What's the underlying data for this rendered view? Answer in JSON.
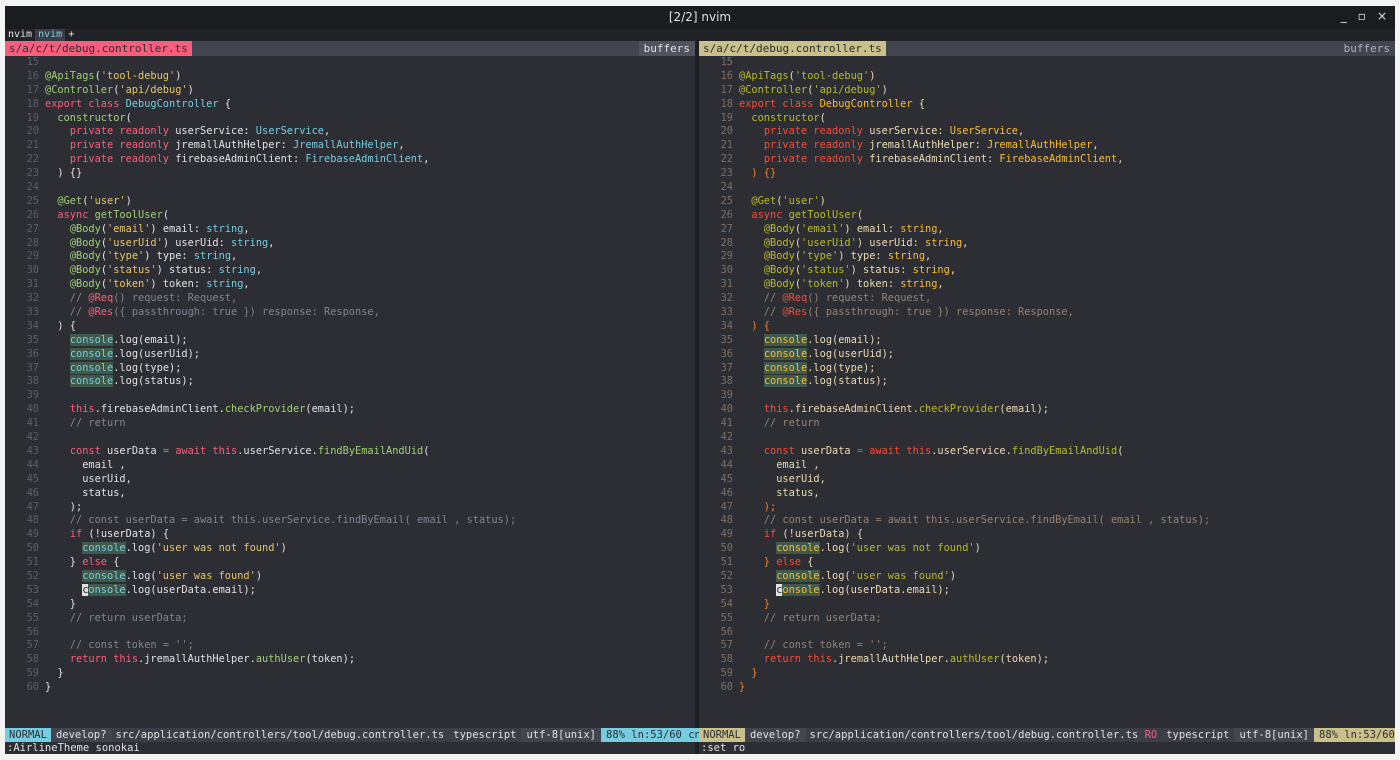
{
  "window": {
    "title": "[2/2] nvim",
    "controls": {
      "minimize": "_",
      "maximize": "▫",
      "close": "×"
    }
  },
  "tabline": {
    "tabs": [
      {
        "label": "nvim",
        "active": false
      },
      {
        "label": "nvim",
        "active": true
      }
    ],
    "add": "+"
  },
  "panes": [
    {
      "filename": "s/a/c/t/debug.controller.ts",
      "buffers_label": "buffers",
      "theme": "sonokai",
      "status": {
        "mode": "NORMAL",
        "branch": "develop?",
        "file": "src/application/controllers/tool/debug.controller.ts",
        "ro": "",
        "filetype": "typescript",
        "encoding": "utf-8[unix]",
        "position": "88% ln:53/60 cn:7"
      },
      "cmdline": ":AirlineTheme sonokai"
    },
    {
      "filename": "s/a/c/t/debug.controller.ts",
      "buffers_label": "buffers",
      "theme": "gruvbox",
      "status": {
        "mode": "NORMAL",
        "branch": "develop?",
        "file": "src/application/controllers/tool/debug.controller.ts",
        "ro": "RO",
        "filetype": "typescript",
        "encoding": "utf-8[unix]",
        "position": "88% ln:53/60 cn:7"
      },
      "cmdline": ":set ro"
    }
  ],
  "themes": {
    "sonokai": {
      "kw": "#fc5d7c",
      "fn": "#9ed072",
      "str": "#e7c664",
      "type": "#76cce0",
      "dec": "#9ed072",
      "cmt": "#7f8490",
      "txt": "#e2e2e3",
      "punc": "#e2e2e3",
      "ln": "#595f6f"
    },
    "gruvbox": {
      "kw": "#fb4934",
      "fn": "#b8bb26",
      "str": "#b8bb26",
      "type": "#fabd2f",
      "dec": "#b8bb26",
      "cmt": "#928374",
      "txt": "#ebdbb2",
      "punc": "#fe8019",
      "ln": "#7c6f64"
    }
  },
  "code": [
    {
      "n": 15,
      "t": []
    },
    {
      "n": 16,
      "t": [
        [
          "dec",
          "@ApiTags"
        ],
        [
          "txt",
          "("
        ],
        [
          "str",
          "'tool-debug'"
        ],
        [
          "txt",
          ")"
        ]
      ]
    },
    {
      "n": 17,
      "t": [
        [
          "dec",
          "@Controller"
        ],
        [
          "txt",
          "("
        ],
        [
          "str",
          "'api/debug'"
        ],
        [
          "txt",
          ")"
        ]
      ]
    },
    {
      "n": 18,
      "t": [
        [
          "kw",
          "export class "
        ],
        [
          "type",
          "DebugController"
        ],
        [
          "txt",
          " {"
        ]
      ]
    },
    {
      "n": 19,
      "t": [
        [
          "txt",
          "  "
        ],
        [
          "fn",
          "constructor"
        ],
        [
          "txt",
          "("
        ]
      ]
    },
    {
      "n": 20,
      "t": [
        [
          "txt",
          "    "
        ],
        [
          "kw",
          "private readonly "
        ],
        [
          "txt",
          "userService: "
        ],
        [
          "type",
          "UserService"
        ],
        [
          "txt",
          ","
        ]
      ]
    },
    {
      "n": 21,
      "t": [
        [
          "txt",
          "    "
        ],
        [
          "kw",
          "private readonly "
        ],
        [
          "txt",
          "jremallAuthHelper: "
        ],
        [
          "type",
          "JremallAuthHelper"
        ],
        [
          "txt",
          ","
        ]
      ]
    },
    {
      "n": 22,
      "t": [
        [
          "txt",
          "    "
        ],
        [
          "kw",
          "private readonly "
        ],
        [
          "txt",
          "firebaseAdminClient: "
        ],
        [
          "type",
          "FirebaseAdminClient"
        ],
        [
          "txt",
          ","
        ]
      ]
    },
    {
      "n": 23,
      "t": [
        [
          "punc",
          "  ) {}"
        ]
      ]
    },
    {
      "n": 24,
      "t": []
    },
    {
      "n": 25,
      "t": [
        [
          "txt",
          "  "
        ],
        [
          "dec",
          "@Get"
        ],
        [
          "txt",
          "("
        ],
        [
          "str",
          "'user'"
        ],
        [
          "txt",
          ")"
        ]
      ]
    },
    {
      "n": 26,
      "t": [
        [
          "txt",
          "  "
        ],
        [
          "kw",
          "async "
        ],
        [
          "fn",
          "getToolUser"
        ],
        [
          "txt",
          "("
        ]
      ]
    },
    {
      "n": 27,
      "t": [
        [
          "txt",
          "    "
        ],
        [
          "dec",
          "@Body"
        ],
        [
          "txt",
          "("
        ],
        [
          "str",
          "'email'"
        ],
        [
          "txt",
          ") email: "
        ],
        [
          "type",
          "string"
        ],
        [
          "txt",
          ","
        ]
      ]
    },
    {
      "n": 28,
      "t": [
        [
          "txt",
          "    "
        ],
        [
          "dec",
          "@Body"
        ],
        [
          "txt",
          "("
        ],
        [
          "str",
          "'userUid'"
        ],
        [
          "txt",
          ") userUid: "
        ],
        [
          "type",
          "string"
        ],
        [
          "txt",
          ","
        ]
      ]
    },
    {
      "n": 29,
      "t": [
        [
          "txt",
          "    "
        ],
        [
          "dec",
          "@Body"
        ],
        [
          "txt",
          "("
        ],
        [
          "str",
          "'type'"
        ],
        [
          "txt",
          ") type: "
        ],
        [
          "type",
          "string"
        ],
        [
          "txt",
          ","
        ]
      ]
    },
    {
      "n": 30,
      "t": [
        [
          "txt",
          "    "
        ],
        [
          "dec",
          "@Body"
        ],
        [
          "txt",
          "("
        ],
        [
          "str",
          "'status'"
        ],
        [
          "txt",
          ") status: "
        ],
        [
          "type",
          "string"
        ],
        [
          "txt",
          ","
        ]
      ]
    },
    {
      "n": 31,
      "t": [
        [
          "txt",
          "    "
        ],
        [
          "dec",
          "@Body"
        ],
        [
          "txt",
          "("
        ],
        [
          "str",
          "'token'"
        ],
        [
          "txt",
          ") token: "
        ],
        [
          "type",
          "string"
        ],
        [
          "txt",
          ","
        ]
      ]
    },
    {
      "n": 32,
      "t": [
        [
          "cmt",
          "    // "
        ],
        [
          "kw",
          "@Req"
        ],
        [
          "cmt",
          "() request: Request,"
        ]
      ]
    },
    {
      "n": 33,
      "t": [
        [
          "cmt",
          "    // "
        ],
        [
          "kw",
          "@Res"
        ],
        [
          "cmt",
          "({ passthrough: true }) response: Response,"
        ]
      ]
    },
    {
      "n": 34,
      "t": [
        [
          "punc",
          "  ) {"
        ]
      ]
    },
    {
      "n": 35,
      "t": [
        [
          "txt",
          "    "
        ],
        [
          "hl",
          "console"
        ],
        [
          "txt",
          ".log(email);"
        ]
      ]
    },
    {
      "n": 36,
      "t": [
        [
          "txt",
          "    "
        ],
        [
          "hl",
          "console"
        ],
        [
          "txt",
          ".log(userUid);"
        ]
      ]
    },
    {
      "n": 37,
      "t": [
        [
          "txt",
          "    "
        ],
        [
          "hl",
          "console"
        ],
        [
          "txt",
          ".log(type);"
        ]
      ]
    },
    {
      "n": 38,
      "t": [
        [
          "txt",
          "    "
        ],
        [
          "hl",
          "console"
        ],
        [
          "txt",
          ".log(status);"
        ]
      ]
    },
    {
      "n": 39,
      "t": []
    },
    {
      "n": 40,
      "t": [
        [
          "txt",
          "    "
        ],
        [
          "kw",
          "this"
        ],
        [
          "txt",
          ".firebaseAdminClient."
        ],
        [
          "fn",
          "checkProvider"
        ],
        [
          "txt",
          "(email);"
        ]
      ]
    },
    {
      "n": 41,
      "t": [
        [
          "cmt",
          "    // return"
        ]
      ]
    },
    {
      "n": 42,
      "t": []
    },
    {
      "n": 43,
      "t": [
        [
          "txt",
          "    "
        ],
        [
          "kw",
          "const "
        ],
        [
          "txt",
          "userData "
        ],
        [
          "kw",
          "= await "
        ],
        [
          "kw",
          "this"
        ],
        [
          "txt",
          ".userService."
        ],
        [
          "fn",
          "findByEmailAndUid"
        ],
        [
          "txt",
          "("
        ]
      ]
    },
    {
      "n": 44,
      "t": [
        [
          "txt",
          "      email ,"
        ]
      ]
    },
    {
      "n": 45,
      "t": [
        [
          "txt",
          "      userUid,"
        ]
      ]
    },
    {
      "n": 46,
      "t": [
        [
          "txt",
          "      status,"
        ]
      ]
    },
    {
      "n": 47,
      "t": [
        [
          "punc",
          "    );"
        ]
      ]
    },
    {
      "n": 48,
      "t": [
        [
          "cmt",
          "    // const userData = await this.userService.findByEmail( email , status);"
        ]
      ]
    },
    {
      "n": 49,
      "t": [
        [
          "txt",
          "    "
        ],
        [
          "kw",
          "if "
        ],
        [
          "txt",
          "(!userData) {"
        ]
      ]
    },
    {
      "n": 50,
      "t": [
        [
          "txt",
          "      "
        ],
        [
          "hl",
          "console"
        ],
        [
          "txt",
          ".log("
        ],
        [
          "str",
          "'user was not found'"
        ],
        [
          "txt",
          ")"
        ]
      ]
    },
    {
      "n": 51,
      "t": [
        [
          "punc",
          "    } "
        ],
        [
          "kw",
          "else "
        ],
        [
          "txt",
          "{"
        ]
      ]
    },
    {
      "n": 52,
      "t": [
        [
          "txt",
          "      "
        ],
        [
          "hl",
          "console"
        ],
        [
          "txt",
          ".log("
        ],
        [
          "str",
          "'user was found'"
        ],
        [
          "txt",
          ")"
        ]
      ]
    },
    {
      "n": 53,
      "t": [
        [
          "txt",
          "      "
        ],
        [
          "cur",
          "c"
        ],
        [
          "hl",
          "onsole"
        ],
        [
          "txt",
          ".log(userData.email);"
        ]
      ]
    },
    {
      "n": 54,
      "t": [
        [
          "punc",
          "    }"
        ]
      ]
    },
    {
      "n": 55,
      "t": [
        [
          "cmt",
          "    // return userData;"
        ]
      ]
    },
    {
      "n": 56,
      "t": []
    },
    {
      "n": 57,
      "t": [
        [
          "cmt",
          "    // const token = '';"
        ]
      ]
    },
    {
      "n": 58,
      "t": [
        [
          "txt",
          "    "
        ],
        [
          "kw",
          "return "
        ],
        [
          "kw",
          "this"
        ],
        [
          "txt",
          ".jremallAuthHelper."
        ],
        [
          "fn",
          "authUser"
        ],
        [
          "txt",
          "(token);"
        ]
      ]
    },
    {
      "n": 59,
      "t": [
        [
          "punc",
          "  }"
        ]
      ]
    },
    {
      "n": 60,
      "t": [
        [
          "punc",
          "}"
        ]
      ]
    }
  ]
}
